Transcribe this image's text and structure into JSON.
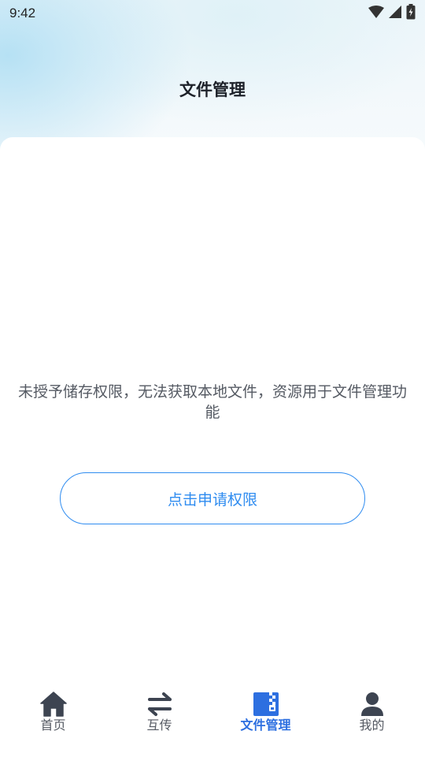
{
  "status_bar": {
    "time": "9:42"
  },
  "header": {
    "title": "文件管理"
  },
  "main": {
    "permission_message": "未授予储存权限，无法获取本地文件，资源用于文件管理功能",
    "request_button_label": "点击申请权限"
  },
  "bottom_nav": {
    "items": [
      {
        "label": "首页",
        "icon": "home-icon",
        "active": false
      },
      {
        "label": "互传",
        "icon": "transfer-icon",
        "active": false
      },
      {
        "label": "文件管理",
        "icon": "file-zip-icon",
        "active": true
      },
      {
        "label": "我的",
        "icon": "person-icon",
        "active": false
      }
    ]
  },
  "colors": {
    "accent": "#2f8cf0",
    "active_nav": "#2d6fe0",
    "icon_dark": "#3d4451",
    "text_gray": "#555a63"
  }
}
